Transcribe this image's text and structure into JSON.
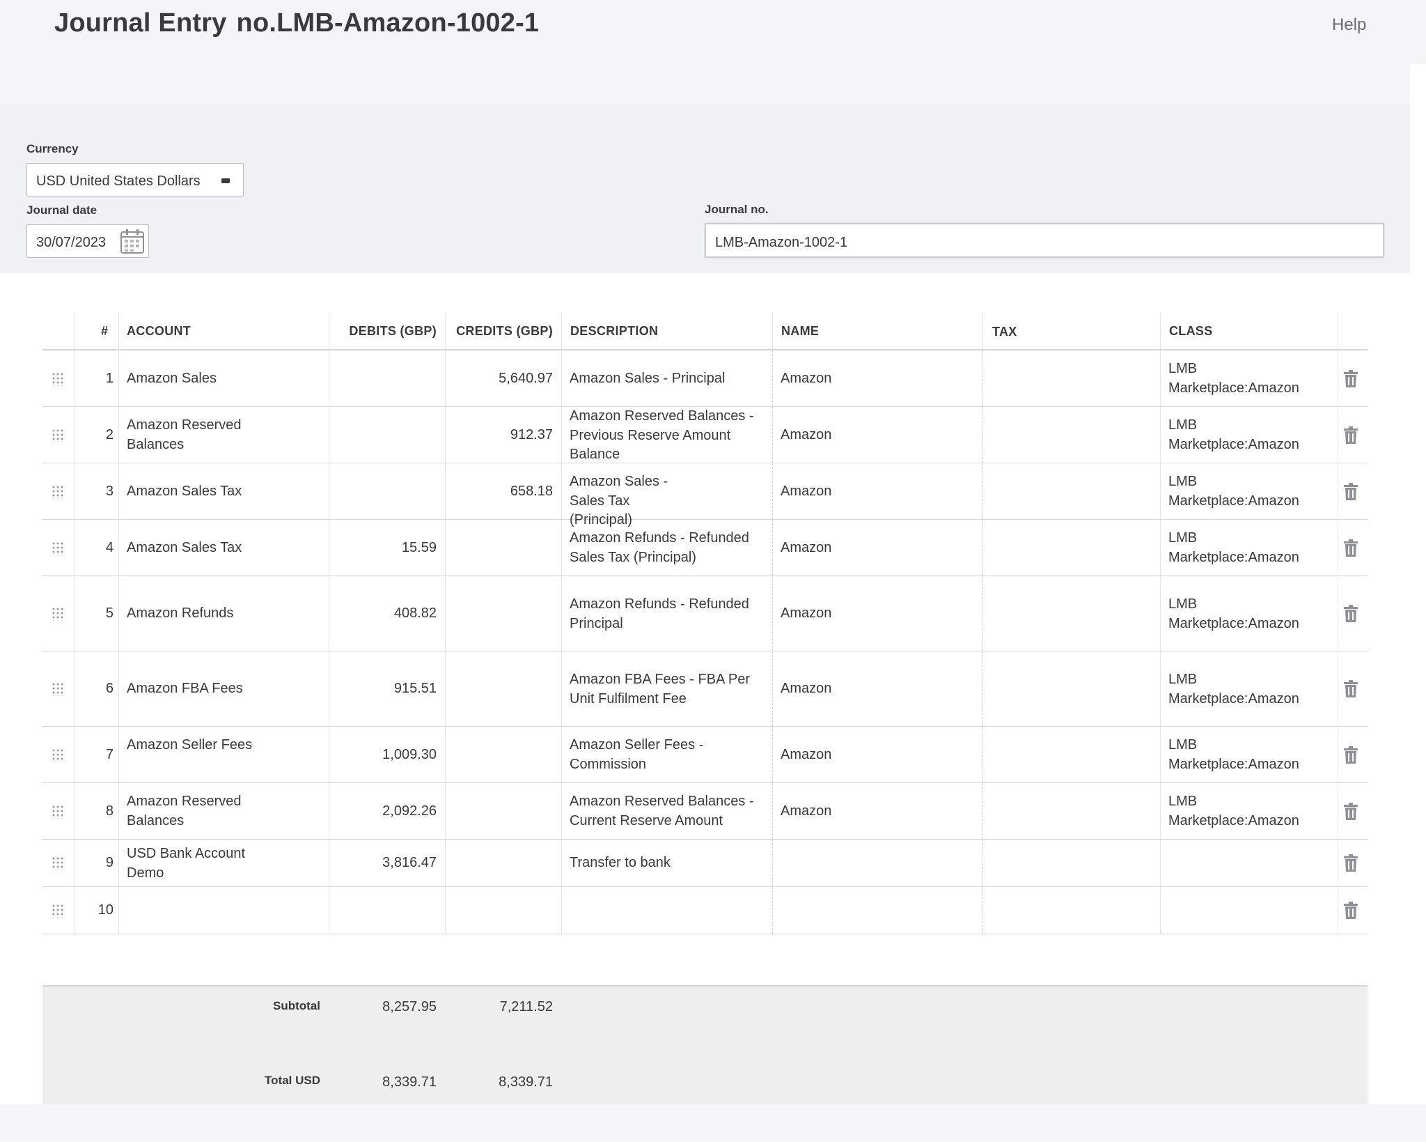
{
  "header": {
    "title_prefix": "Journal Entry",
    "title_number": "no.LMB-Amazon-1002-1",
    "help_label": "Help"
  },
  "form": {
    "currency_label": "Currency",
    "currency_value": "USD United States Dollars",
    "journal_date_label": "Journal date",
    "journal_date_value": "30/07/2023",
    "journal_no_label": "Journal no.",
    "journal_no_value": "LMB-Amazon-1002-1"
  },
  "table": {
    "columns": {
      "number": "#",
      "account": "ACCOUNT",
      "debits": "DEBITS (GBP)",
      "credits": "CREDITS (GBP)",
      "description": "DESCRIPTION",
      "name": "NAME",
      "tax": "TAX",
      "class": "CLASS"
    },
    "rows": [
      {
        "num": "1",
        "account": "Amazon Sales",
        "debit": "",
        "credit": "5,640.97",
        "description": "Amazon Sales - Principal",
        "name": "Amazon",
        "tax": "",
        "class": "LMB Marketplace:Amazon"
      },
      {
        "num": "2",
        "account": "Amazon Reserved Balances",
        "debit": "",
        "credit": "912.37",
        "description": "Amazon Reserved Balances - Previous Reserve Amount Balance",
        "name": "Amazon",
        "tax": "",
        "class": "LMB Marketplace:Amazon"
      },
      {
        "num": "3",
        "account": "Amazon Sales Tax",
        "debit": "",
        "credit": "658.18",
        "description": "Amazon Sales - Sales Tax (Principal)",
        "name": "Amazon",
        "tax": "",
        "class": "LMB Marketplace:Amazon"
      },
      {
        "num": "4",
        "account": "Amazon Sales Tax",
        "debit": "15.59",
        "credit": "",
        "description": "Amazon Refunds - Refunded Sales Tax (Principal)",
        "name": "Amazon",
        "tax": "",
        "class": "LMB Marketplace:Amazon"
      },
      {
        "num": "5",
        "account": "Amazon Refunds",
        "debit": "408.82",
        "credit": "",
        "description": "Amazon Refunds - Refunded Principal",
        "name": "Amazon",
        "tax": "",
        "class": "LMB Marketplace:Amazon"
      },
      {
        "num": "6",
        "account": "Amazon FBA Fees",
        "debit": "915.51",
        "credit": "",
        "description": "Amazon FBA Fees - FBA Per Unit Fulfilment Fee",
        "name": "Amazon",
        "tax": "",
        "class": "LMB Marketplace:Amazon"
      },
      {
        "num": "7",
        "account": "Amazon Seller Fees",
        "debit": "1,009.30",
        "credit": "",
        "description": "Amazon Seller Fees - Commission",
        "name": "Amazon",
        "tax": "",
        "class": "LMB Marketplace:Amazon"
      },
      {
        "num": "8",
        "account": "Amazon Reserved Balances",
        "debit": "2,092.26",
        "credit": "",
        "description": "Amazon Reserved Balances - Current Reserve Amount",
        "name": "Amazon",
        "tax": "",
        "class": "LMB Marketplace:Amazon"
      },
      {
        "num": "9",
        "account": "USD Bank Account Demo",
        "debit": "3,816.47",
        "credit": "",
        "description": "Transfer to bank",
        "name": "",
        "tax": "",
        "class": ""
      },
      {
        "num": "10",
        "account": "",
        "debit": "",
        "credit": "",
        "description": "",
        "name": "",
        "tax": "",
        "class": ""
      }
    ]
  },
  "totals": {
    "subtotal_label": "Subtotal",
    "subtotal_debits": "8,257.95",
    "subtotal_credits": "7,211.52",
    "total_label": "Total USD",
    "total_debits": "8,339.71",
    "total_credits": "8,339.71"
  },
  "icons": {
    "currency_caret": "chevron-down-icon",
    "calendar": "calendar-icon",
    "drag": "drag-handle-icon",
    "delete": "trash-icon"
  }
}
